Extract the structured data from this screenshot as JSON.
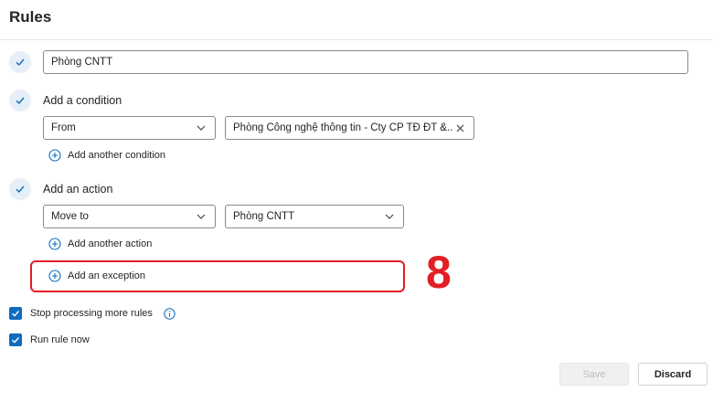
{
  "header": {
    "title": "Rules"
  },
  "rule_name": {
    "value": "Phòng CNTT"
  },
  "condition": {
    "label": "Add a condition",
    "type_value": "From",
    "value": "Phòng Công nghệ thông tin - Cty CP TĐ ĐT &...",
    "add_link": "Add another condition"
  },
  "action": {
    "label": "Add an action",
    "type_value": "Move to",
    "folder_value": "Phòng CNTT",
    "add_link": "Add another action"
  },
  "exception": {
    "add_link": "Add an exception"
  },
  "annotation": {
    "number": "8",
    "color": "#e31e24"
  },
  "options": {
    "stop_processing": {
      "label": "Stop processing more rules",
      "checked": true
    },
    "run_now": {
      "label": "Run rule now",
      "checked": true
    }
  },
  "footer": {
    "save_label": "Save",
    "discard_label": "Discard"
  },
  "colors": {
    "accent": "#0f6cbd"
  },
  "icons": [
    "check-icon",
    "chevron-down-icon",
    "close-icon",
    "plus-circle-icon",
    "info-icon",
    "checkbox-check-icon"
  ]
}
